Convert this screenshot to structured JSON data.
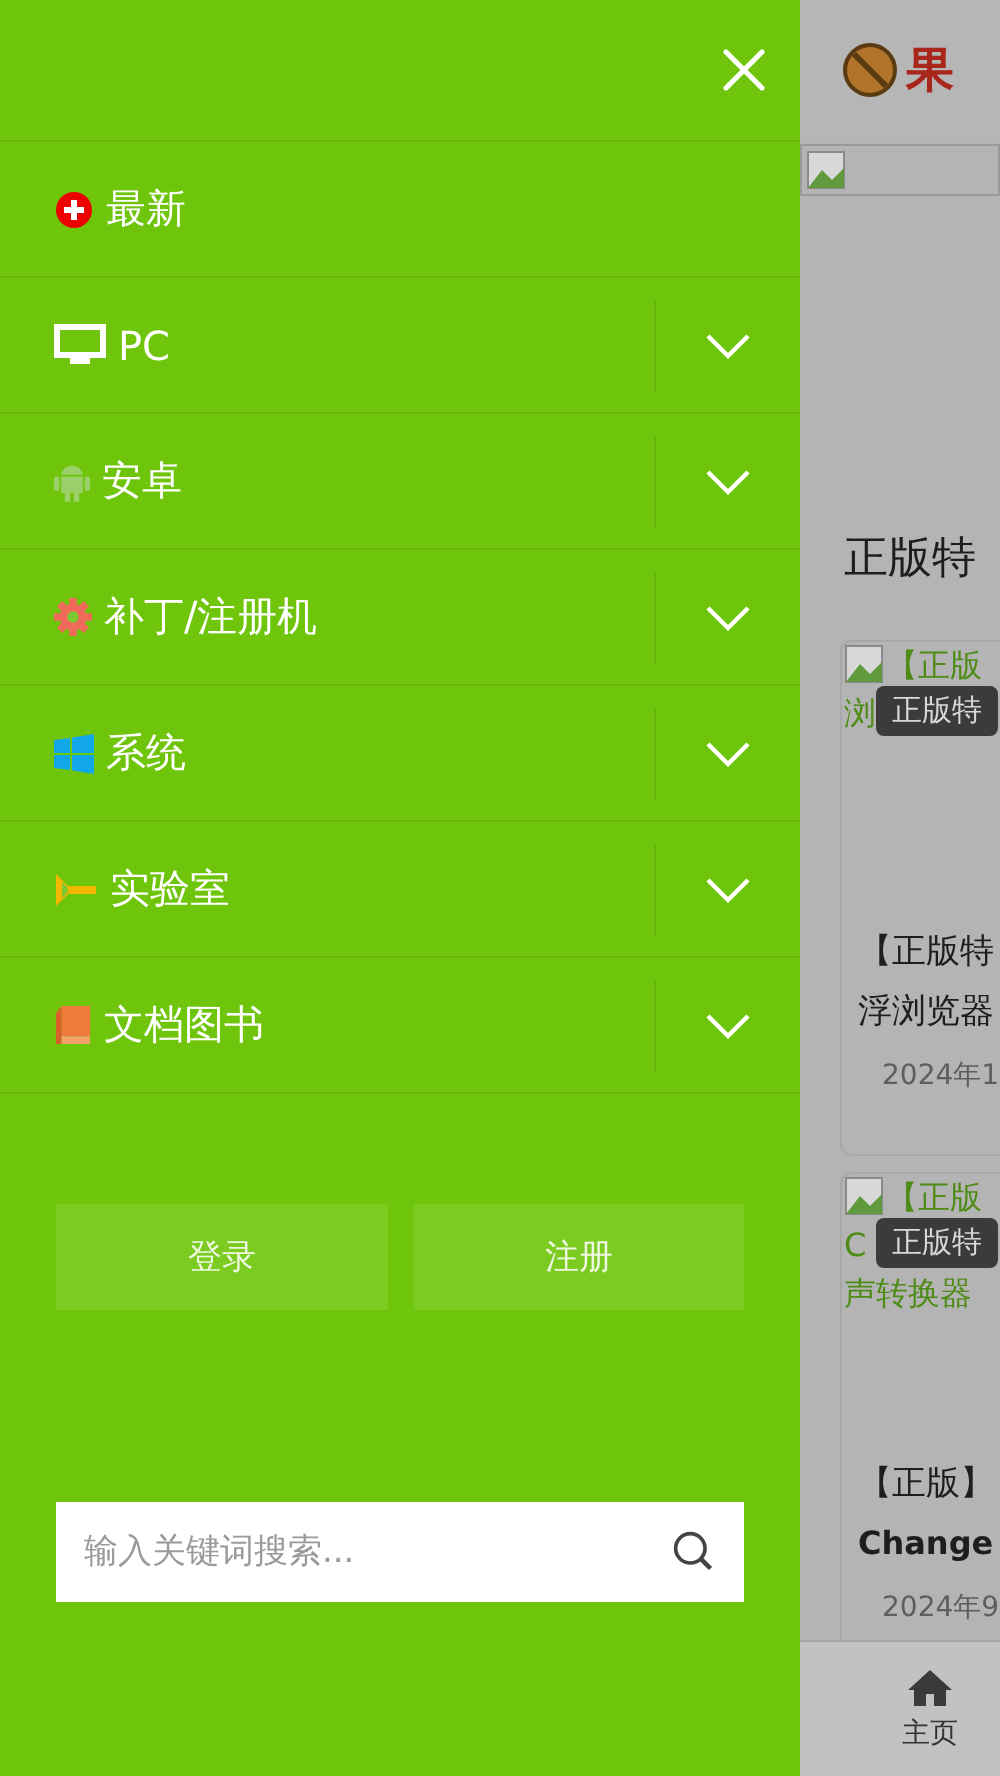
{
  "drawer": {
    "menu": [
      {
        "kind": "new",
        "label": "最新",
        "expandable": false
      },
      {
        "kind": "pc",
        "label": "PC",
        "expandable": true
      },
      {
        "kind": "android",
        "label": "安卓",
        "expandable": true
      },
      {
        "kind": "patch",
        "label": "补丁/注册机",
        "expandable": true
      },
      {
        "kind": "windows",
        "label": "系统",
        "expandable": true
      },
      {
        "kind": "lab",
        "label": "实验室",
        "expandable": true
      },
      {
        "kind": "book",
        "label": "文档图书",
        "expandable": true
      }
    ],
    "buttons": [
      "登录",
      "注册"
    ],
    "search": {
      "placeholder": "输入关键词搜索..."
    }
  },
  "page": {
    "logo_text": "果",
    "headline": "正版特",
    "cards": [
      {
        "link_lines": [
          "【正版",
          "浏"
        ],
        "tooltip": "正版特",
        "title_lines": [
          "【正版特",
          "浮浏览器"
        ],
        "date": "2024年1"
      },
      {
        "link_lines": [
          "【正版",
          "C",
          "声转换器"
        ],
        "tooltip": "正版特",
        "title_lines": [
          "【正版】",
          "Change"
        ],
        "date": "2024年9"
      }
    ],
    "nav": {
      "label": "主页"
    }
  }
}
